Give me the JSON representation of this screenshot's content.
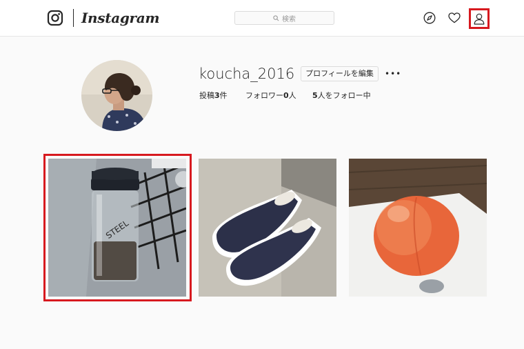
{
  "app": {
    "wordmark": "Instagram"
  },
  "header": {
    "search": {
      "placeholder": "検索"
    },
    "icons": [
      "explore-compass-icon",
      "activity-heart-icon",
      "profile-person-icon"
    ]
  },
  "profile": {
    "username": "koucha_2016",
    "edit_label": "プロフィールを編集",
    "more_label": "•••",
    "stats": {
      "posts_prefix": "投稿",
      "posts_count": "3",
      "posts_suffix": "件",
      "followers_prefix": "フォロワー",
      "followers_count": "0",
      "followers_suffix": "人",
      "following_count": "5",
      "following_suffix": "人をフォロー中"
    }
  },
  "posts": [
    {
      "subject": "drink bottle on kitchen counter"
    },
    {
      "subject": "navy slip-on sneakers"
    },
    {
      "subject": "peach on white plate"
    }
  ],
  "colors": {
    "highlight": "#d7191f",
    "text": "#262626",
    "background": "#fafafa"
  }
}
